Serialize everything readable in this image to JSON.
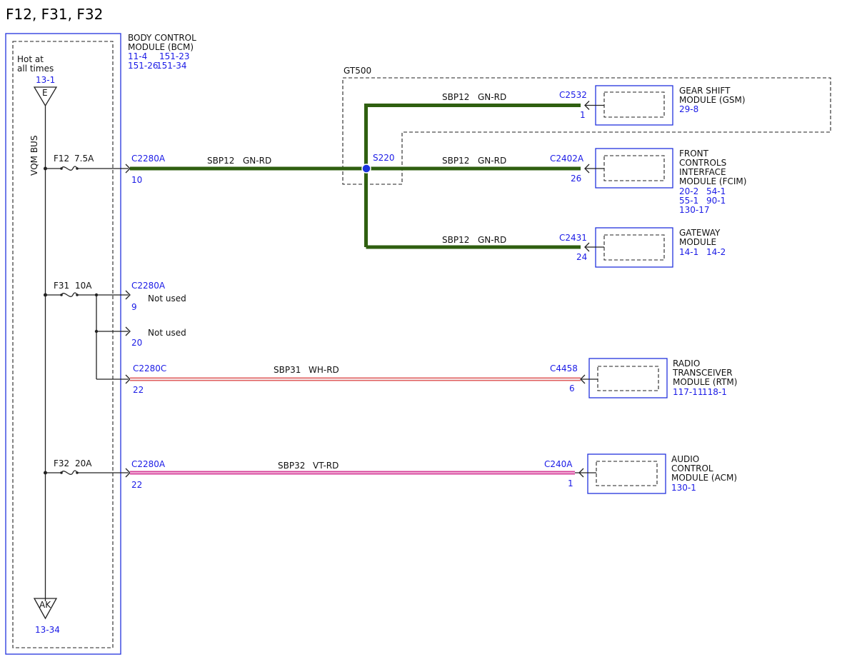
{
  "page_title": "F12, F31, F32",
  "colors": {
    "connector_text": "#1a1ae6",
    "module_border": "#2233dd",
    "wire_green": "#2f5f10",
    "wire_red_stripe": "#e06060",
    "wire_pink": "#d6409a",
    "splice_blue": "#1a33dd"
  },
  "bcm": {
    "name_line1": "BODY CONTROL",
    "name_line2": "MODULE (BCM)",
    "ref1": "11-4",
    "ref2": "151-23",
    "ref3": "151-26",
    "ref4": "151-34",
    "hot_line1": "Hot at",
    "hot_line2": "all times",
    "hot_ref": "13-1",
    "bus_label": "VQM BUS",
    "top_flag": "E",
    "bottom_flag": "AK",
    "bottom_ref": "13-34"
  },
  "fuses": {
    "f12": "F12",
    "f12_rating": "7.5A",
    "f31": "F31",
    "f31_rating": "10A",
    "f32": "F32",
    "f32_rating": "20A"
  },
  "gt500": {
    "label": "GT500"
  },
  "splice": {
    "label": "S220"
  },
  "circuits": {
    "main": {
      "connector": "C2280A",
      "pin": "10",
      "wire": "SBP12",
      "color": "GN-RD"
    },
    "gsm": {
      "connector": "C2532",
      "pin": "1",
      "wire": "SBP12",
      "color": "GN-RD"
    },
    "fcim": {
      "connector": "C2402A",
      "pin": "26",
      "wire": "SBP12",
      "color": "GN-RD"
    },
    "gateway": {
      "connector": "C2431",
      "pin": "24",
      "wire": "SBP12",
      "color": "GN-RD"
    },
    "unused1": {
      "connector": "C2280A",
      "pin": "9",
      "note": "Not used"
    },
    "unused2": {
      "pin": "20",
      "note": "Not used"
    },
    "rtm": {
      "bcm_connector": "C2280C",
      "bcm_pin": "22",
      "connector": "C4458",
      "pin": "6",
      "wire": "SBP31",
      "color": "WH-RD"
    },
    "acm": {
      "bcm_connector": "C2280A",
      "bcm_pin": "22",
      "connector": "C240A",
      "pin": "1",
      "wire": "SBP32",
      "color": "VT-RD"
    }
  },
  "modules": {
    "gsm": {
      "line1": "GEAR SHIFT",
      "line2": "MODULE (GSM)",
      "ref1": "29-8"
    },
    "fcim": {
      "line1": "FRONT",
      "line2": "CONTROLS",
      "line3": "INTERFACE",
      "line4": "MODULE (FCIM)",
      "ref1": "20-2",
      "ref2": "54-1",
      "ref3": "55-1",
      "ref4": "90-1",
      "ref5": "130-17"
    },
    "gateway": {
      "line1": "GATEWAY",
      "line2": "MODULE",
      "ref1": "14-1",
      "ref2": "14-2"
    },
    "rtm": {
      "line1": "RADIO",
      "line2": "TRANSCEIVER",
      "line3": "MODULE (RTM)",
      "ref1": "117-11",
      "ref2": "118-1"
    },
    "acm": {
      "line1": "AUDIO",
      "line2": "CONTROL",
      "line3": "MODULE (ACM)",
      "ref1": "130-1"
    }
  }
}
